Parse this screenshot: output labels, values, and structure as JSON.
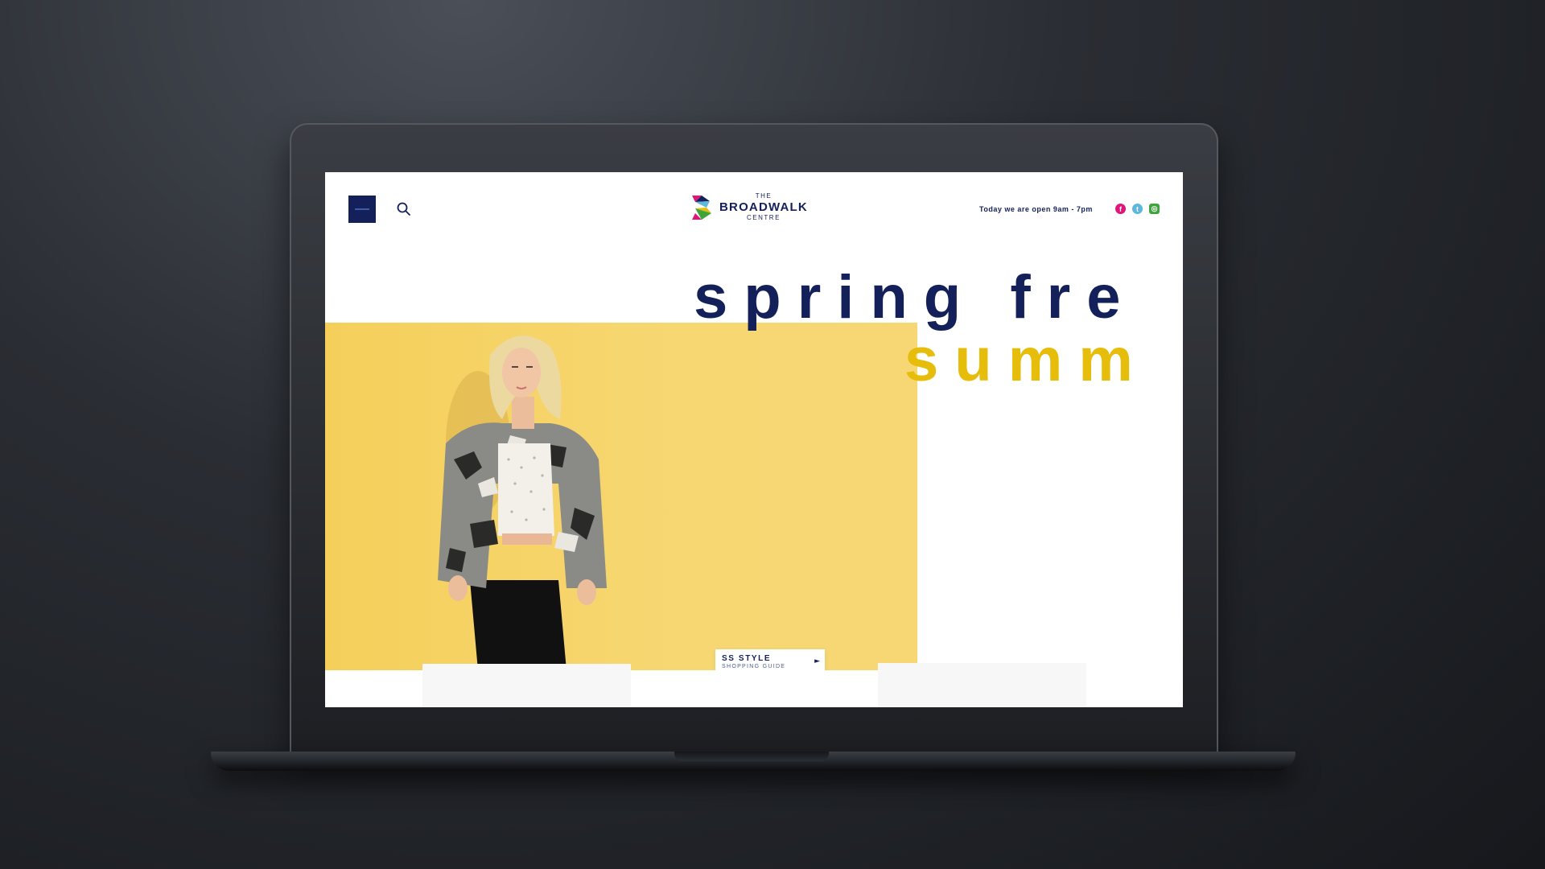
{
  "header": {
    "logo_the": "THE",
    "logo_name": "BROADWALK",
    "logo_centre": "CENTRE",
    "opening_hours": "Today we are open 9am - 7pm",
    "social": [
      {
        "name": "facebook",
        "glyph": "f",
        "color": "#e0157a"
      },
      {
        "name": "twitter",
        "glyph": "t",
        "color": "#5db7df"
      },
      {
        "name": "instagram",
        "glyph": "◎",
        "color": "#3ea53a"
      }
    ]
  },
  "hero": {
    "headline_line1": "spring fre",
    "headline_line2": "summ",
    "cta_title": "SS STYLE",
    "cta_subtitle": "SHOPPING GUIDE",
    "cta_arrow": "►"
  },
  "colors": {
    "navy": "#14205a",
    "mustard": "#e5bd0a",
    "hero_yellow": "#f6d772"
  }
}
